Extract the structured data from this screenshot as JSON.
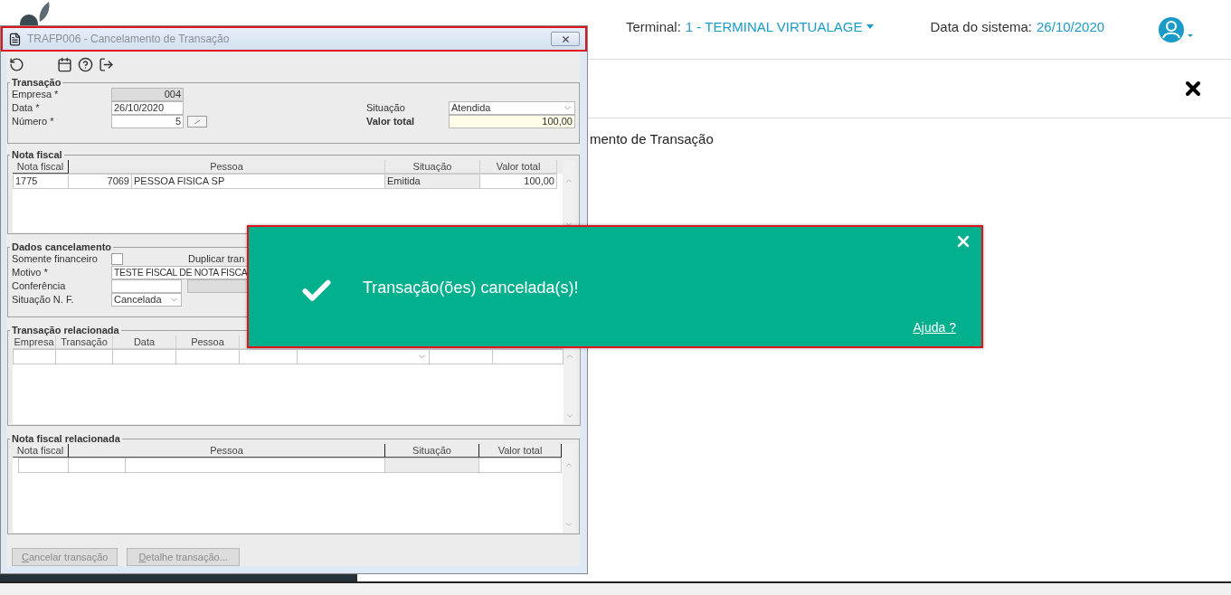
{
  "header": {
    "terminal_label": "Terminal:",
    "terminal_value": "1 - TERMINAL VIRTUALAGE",
    "date_label": "Data do sistema:",
    "date_value": "26/10/2020"
  },
  "page": {
    "heading": "mento de Transação"
  },
  "dialog": {
    "title": "TRAFP006 - Cancelamento de Transação",
    "transacao": {
      "title": "Transação",
      "empresa": {
        "label": "Empresa *",
        "value": "004"
      },
      "data": {
        "label": "Data *",
        "value": "26/10/2020"
      },
      "numero": {
        "label": "Número *",
        "value": "5"
      },
      "situacao": {
        "label": "Situação",
        "value": "Atendida"
      },
      "valor_total": {
        "label": "Valor total",
        "value": "100,00"
      }
    },
    "nota_fiscal": {
      "title": "Nota fiscal",
      "columns": [
        "Nota fiscal",
        "Pessoa",
        "Situação",
        "Valor total"
      ],
      "rows": [
        {
          "nota_fiscal": "1775",
          "pessoa_codigo": "7069",
          "pessoa_nome": "PESSOA FISICA SP",
          "situacao": "Emitida",
          "valor_total": "100,00"
        }
      ]
    },
    "dados_cancelamento": {
      "title": "Dados cancelamento",
      "somente_financeiro": {
        "label": "Somente financeiro",
        "checked": false
      },
      "duplicar_label": "Duplicar tran",
      "motivo": {
        "label": "Motivo *",
        "value": "TESTE FISCAL DE NOTA FISCA"
      },
      "conferencia": {
        "label": "Conferência"
      },
      "situacao_nf": {
        "label": "Situação N. F.",
        "value": "Cancelada"
      }
    },
    "transacao_relacionada": {
      "title": "Transação relacionada",
      "columns": [
        "Empresa",
        "Transação",
        "Data",
        "Pessoa"
      ]
    },
    "nota_fiscal_relacionada": {
      "title": "Nota fiscal relacionada",
      "columns": [
        "Nota fiscal",
        "Pessoa",
        "Situação",
        "Valor total"
      ]
    },
    "buttons": [
      {
        "label": "Cancelar transação",
        "disabled": true
      },
      {
        "label": "Detalhe transação...",
        "disabled": true
      }
    ]
  },
  "toast": {
    "message": "Transação(ões) cancelada(s)!",
    "link": "Ajuda ?"
  }
}
